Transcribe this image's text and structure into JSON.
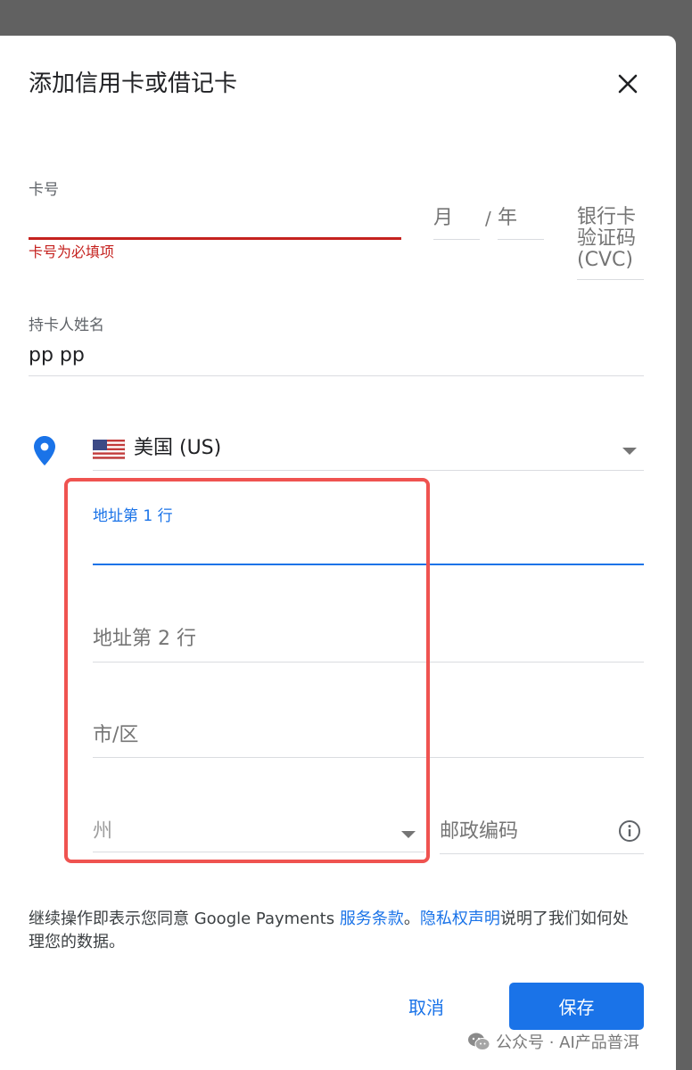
{
  "dialog": {
    "title": "添加信用卡或借记卡"
  },
  "card_number": {
    "label": "卡号",
    "value": "",
    "error": "卡号为必填项"
  },
  "expiry": {
    "month_placeholder": "月",
    "separator": "/",
    "year_placeholder": "年"
  },
  "cvc": {
    "placeholder": "银行卡验证码 (CVC)"
  },
  "cardholder": {
    "label": "持卡人姓名",
    "value": "pp pp"
  },
  "country": {
    "value": "美国 (US)"
  },
  "address_line1": {
    "label": "地址第 1 行",
    "value": ""
  },
  "address_line2": {
    "placeholder": "地址第 2 行"
  },
  "city": {
    "placeholder": "市/区"
  },
  "state": {
    "placeholder": "州"
  },
  "postal_code": {
    "placeholder": "邮政编码"
  },
  "legal": {
    "prefix": "继续操作即表示您同意 Google Payments ",
    "terms_link": "服务条款",
    "mid": "。",
    "privacy_link": "隐私权声明",
    "suffix": "说明了我们如何处理您的数据。"
  },
  "actions": {
    "cancel": "取消",
    "save": "保存"
  },
  "watermark": {
    "text": "公众号 · AI产品普洱"
  },
  "colors": {
    "accent": "#1a73e8",
    "error": "#c5221f",
    "highlight": "#ef5350"
  }
}
